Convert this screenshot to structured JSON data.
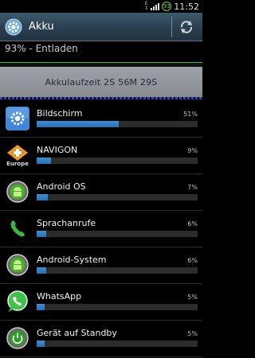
{
  "status_bar": {
    "network_label": "E",
    "battery_level": "93",
    "time": "11:52"
  },
  "titlebar": {
    "title": "Akku",
    "icon": "gear-icon",
    "refresh_icon": "refresh-icon"
  },
  "subheader": {
    "status_text": "93% - Entladen"
  },
  "graph": {
    "runtime_text": "Akkulaufzeit 2S 56M 29S"
  },
  "usage_list": [
    {
      "name": "Bildschirm",
      "percent": "51%",
      "fraction": 0.51,
      "icon": "display-settings-icon"
    },
    {
      "name": "NAVIGON",
      "percent": "9%",
      "fraction": 0.09,
      "icon": "navigon-logo-icon",
      "icon_caption": "Europe"
    },
    {
      "name": "Android OS",
      "percent": "7%",
      "fraction": 0.07,
      "icon": "android-os-icon"
    },
    {
      "name": "Sprachanrufe",
      "percent": "6%",
      "fraction": 0.06,
      "icon": "phone-icon"
    },
    {
      "name": "Android-System",
      "percent": "6%",
      "fraction": 0.06,
      "icon": "android-system-icon"
    },
    {
      "name": "WhatsApp",
      "percent": "5%",
      "fraction": 0.05,
      "icon": "whatsapp-icon"
    },
    {
      "name": "Gerät auf Standby",
      "percent": "5%",
      "fraction": 0.05,
      "icon": "standby-icon"
    }
  ],
  "colors": {
    "bar": "#2a6fb5",
    "titlebar": "#2a3f4f",
    "graph_line": "#3cbf3c"
  }
}
